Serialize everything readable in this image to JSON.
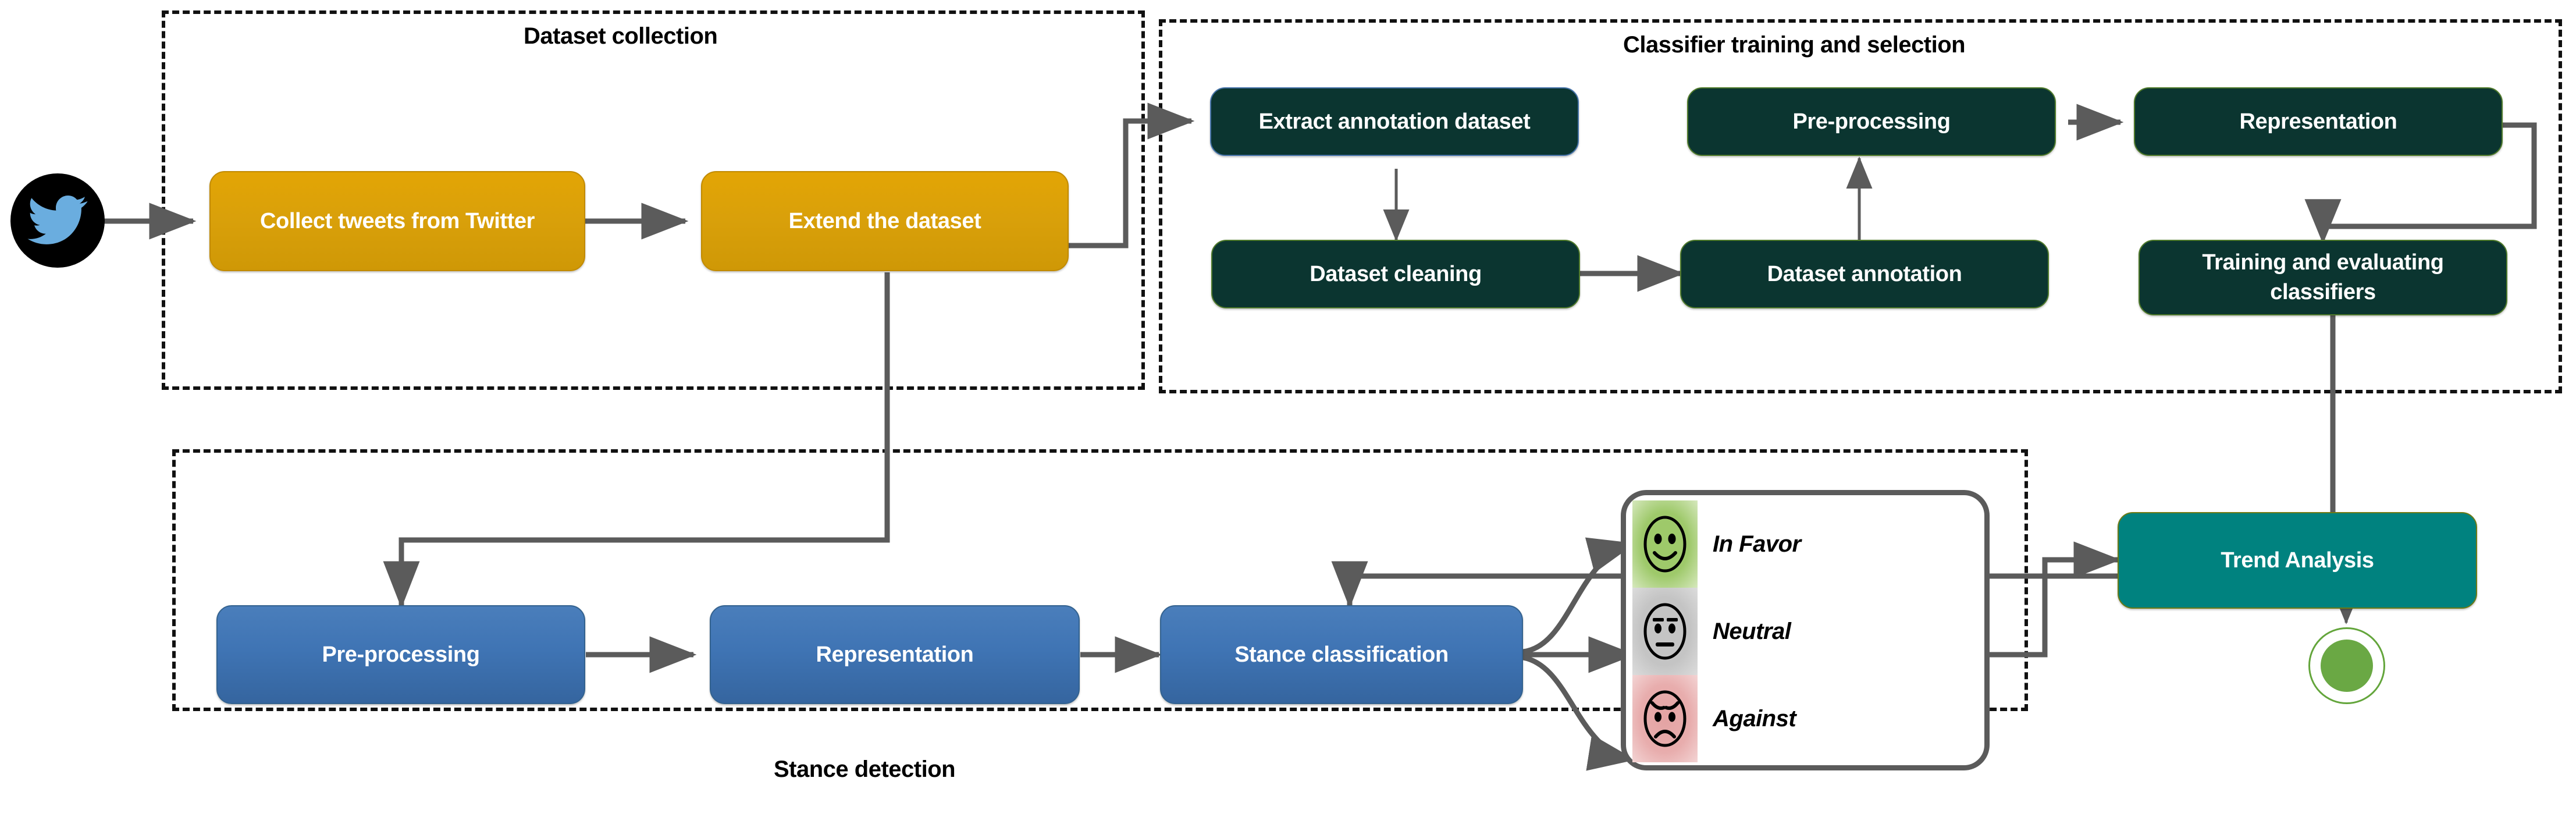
{
  "diagram": {
    "title_alt": "Stance detection pipeline",
    "groups": [
      {
        "id": "dataset_collection",
        "label": "Dataset collection"
      },
      {
        "id": "classifier_training",
        "label": "Classifier training and selection"
      },
      {
        "id": "stance_detection",
        "label": "Stance detection"
      }
    ],
    "source": {
      "icon": "twitter-bird-icon",
      "label": "Twitter"
    },
    "nodes": {
      "collect_tweets": "Collect tweets from Twitter",
      "extend_dataset": "Extend the dataset",
      "extract_annotation": "Extract annotation dataset",
      "dataset_cleaning": "Dataset cleaning",
      "dataset_annotation": "Dataset annotation",
      "ct_preprocessing": "Pre-processing",
      "ct_representation": "Representation",
      "training_eval": "Training and evaluating classifiers",
      "sd_preprocessing": "Pre-processing",
      "sd_representation": "Representation",
      "stance_classification": "Stance classification",
      "trend_analysis": "Trend Analysis"
    },
    "stance_classes": [
      {
        "label": "In Favor",
        "icon": "smiling-face-icon",
        "color": "#9ec96a"
      },
      {
        "label": "Neutral",
        "icon": "neutral-face-icon",
        "color": "#c4c4c4"
      },
      {
        "label": "Against",
        "icon": "angry-face-icon",
        "color": "#e3a3a3"
      }
    ],
    "colors": {
      "orange": "#d9a00a",
      "dark_green": "#0b3530",
      "blue": "#3f74b4",
      "teal": "#00827f",
      "end_circle": "#6aa844",
      "connector": "#5b5b5b",
      "twitter_blue": "#6aaddf",
      "twitter_bg": "#000000"
    }
  }
}
